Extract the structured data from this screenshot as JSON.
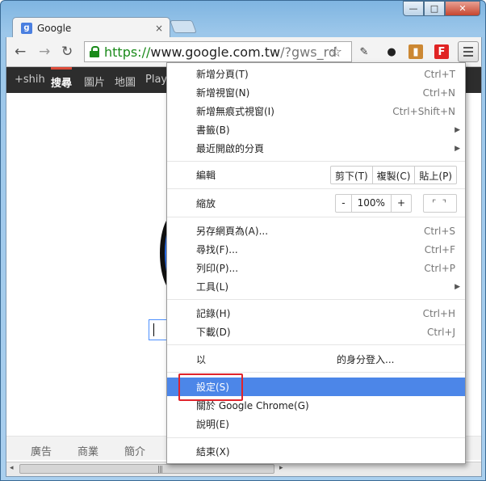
{
  "window": {
    "controls": {
      "minimize": "—",
      "maximize": "□",
      "close": "✕"
    }
  },
  "tab": {
    "favicon": "g",
    "title": "Google",
    "close": "×"
  },
  "toolbar": {
    "back": "←",
    "forward": "→",
    "reload": "↻",
    "url_https": "https://",
    "url_host": "www.google.com.tw",
    "url_rest": "/?gws_rd",
    "star": "☆"
  },
  "gbar": {
    "items": [
      "+shih",
      "搜尋",
      "圖片",
      "地圖",
      "Play"
    ]
  },
  "footer": {
    "items": [
      "廣告",
      "商業",
      "簡介"
    ]
  },
  "scrollbar": {
    "left": "◂",
    "right": "▸",
    "grip": "|||"
  },
  "menu": {
    "new_tab": {
      "label": "新增分頁(T)",
      "shortcut": "Ctrl+T"
    },
    "new_window": {
      "label": "新增視窗(N)",
      "shortcut": "Ctrl+N"
    },
    "incognito": {
      "label": "新增無痕式視窗(I)",
      "shortcut": "Ctrl+Shift+N"
    },
    "bookmarks": {
      "label": "書籤(B)"
    },
    "recent_tabs": {
      "label": "最近開啟的分頁"
    },
    "edit": {
      "label": "編輯",
      "cut": "剪下(T)",
      "copy": "複製(C)",
      "paste": "貼上(P)"
    },
    "zoom": {
      "label": "縮放",
      "minus": "-",
      "value": "100%",
      "plus": "+",
      "fullscreen": "⌜ ⌝"
    },
    "save_as": {
      "label": "另存網頁為(A)...",
      "shortcut": "Ctrl+S"
    },
    "find": {
      "label": "尋找(F)...",
      "shortcut": "Ctrl+F"
    },
    "print": {
      "label": "列印(P)...",
      "shortcut": "Ctrl+P"
    },
    "tools": {
      "label": "工具(L)"
    },
    "history": {
      "label": "記錄(H)",
      "shortcut": "Ctrl+H"
    },
    "downloads": {
      "label": "下載(D)",
      "shortcut": "Ctrl+J"
    },
    "signin_prefix": {
      "label": "以"
    },
    "signin_suffix": {
      "label": "的身分登入..."
    },
    "settings": {
      "label": "設定(S)"
    },
    "about": {
      "label": "關於 Google Chrome(G)"
    },
    "help": {
      "label": "說明(E)"
    },
    "exit": {
      "label": "結束(X)"
    }
  }
}
